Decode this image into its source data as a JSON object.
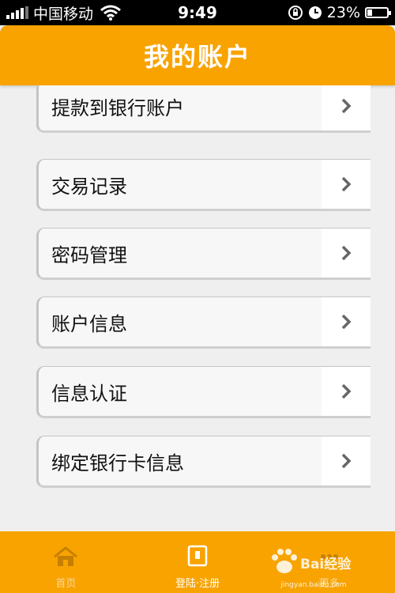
{
  "status_bar": {
    "carrier": "中国移动",
    "time": "9:49",
    "battery": "23%",
    "battery_level": 0.23
  },
  "header": {
    "title": "我的账户"
  },
  "menu": {
    "items": [
      {
        "label": "提款到银行账户"
      },
      {
        "label": "交易记录"
      },
      {
        "label": "密码管理"
      },
      {
        "label": "账户信息"
      },
      {
        "label": "信息认证"
      },
      {
        "label": "绑定银行卡信息"
      }
    ]
  },
  "tabbar": {
    "tabs": [
      {
        "label": "首页"
      },
      {
        "label": "登陆·注册"
      },
      {
        "label": "更多"
      }
    ]
  },
  "watermark": {
    "text": "Bai经验",
    "sub": "jingyan.baidu.com"
  },
  "colors": {
    "accent": "#f8a300"
  }
}
